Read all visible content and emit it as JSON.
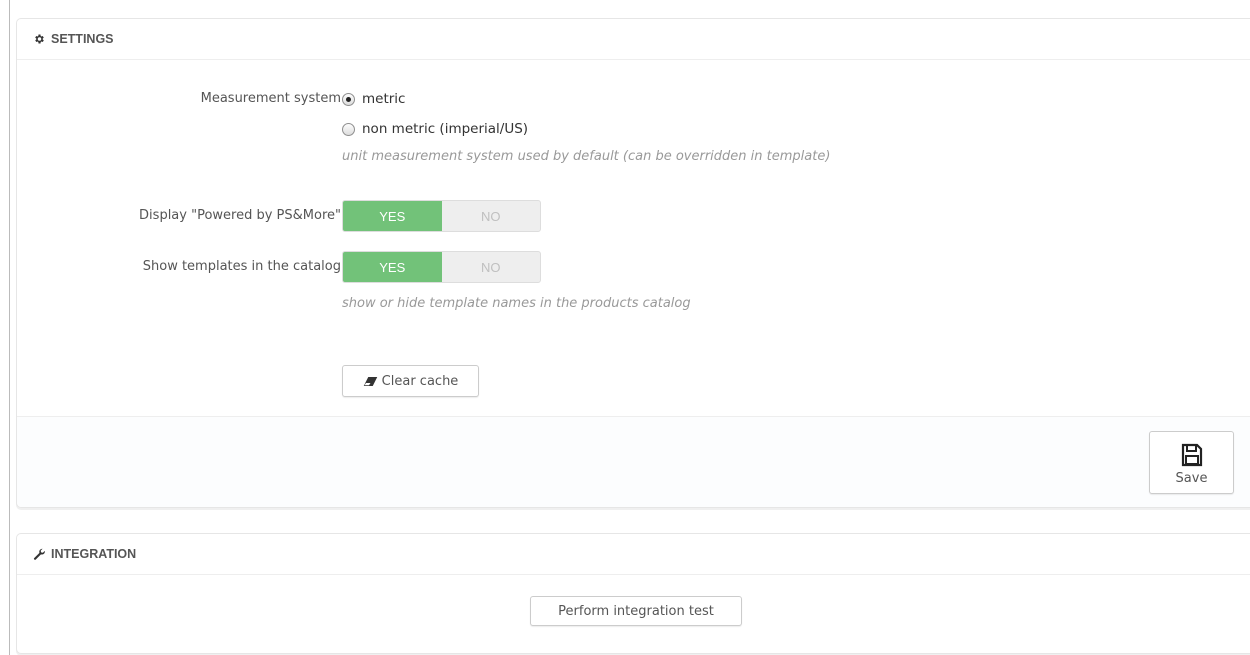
{
  "settings": {
    "heading": "SETTINGS",
    "heading_icon": "gear-icon",
    "measurement": {
      "label": "Measurement system",
      "options": [
        {
          "label": "metric",
          "checked": true
        },
        {
          "label": "non metric (imperial/US)",
          "checked": false
        }
      ],
      "help": "unit measurement system used by default (can be overridden in template)"
    },
    "powered_by": {
      "label": "Display \"Powered by PS&More\"",
      "yes": "YES",
      "no": "NO",
      "selected": "YES"
    },
    "show_templates": {
      "label": "Show templates in the catalog",
      "yes": "YES",
      "no": "NO",
      "selected": "YES",
      "help": "show or hide template names in the products catalog"
    },
    "clear_cache": {
      "label": "Clear cache",
      "icon": "eraser-icon"
    },
    "save": {
      "label": "Save",
      "icon": "floppy-disk-icon"
    }
  },
  "integration": {
    "heading": "INTEGRATION",
    "heading_icon": "wrench-icon",
    "test_button": "Perform integration test"
  },
  "colors": {
    "switch_on": "#72c279",
    "switch_off": "#eeeeee",
    "help_text": "#999999"
  }
}
